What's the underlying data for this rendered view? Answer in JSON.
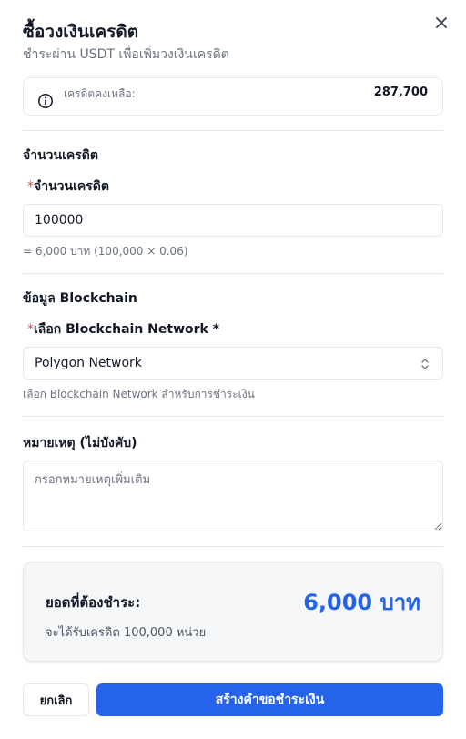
{
  "dialog": {
    "title": "ซื้อวงเงินเครดิต",
    "subtitle": "ชำระผ่าน USDT เพื่อเพิ่มวงเงินเครดิต",
    "close_icon": "close-icon"
  },
  "balance": {
    "label": "เครดิตคงเหลือ:",
    "value": "287,700",
    "icon": "info-icon"
  },
  "amount_section": {
    "title": "จำนวนเครดิต",
    "required_mark": "*",
    "field_label": "จำนวนเครดิต",
    "value": "100000",
    "calc_text": "= 6,000 บาท (100,000 × 0.06)"
  },
  "blockchain_section": {
    "title": "ข้อมูล Blockchain",
    "required_mark": "*",
    "field_label": "เลือก Blockchain Network *",
    "selected": "Polygon Network",
    "help": "เลือก Blockchain Network สำหรับการชำระเงิน"
  },
  "note_section": {
    "title": "หมายเหตุ (ไม่บังคับ)",
    "placeholder": "กรอกหมายเหตุเพิ่มเติม",
    "value": ""
  },
  "summary": {
    "label": "ยอดที่ต้องชำระ:",
    "amount": "6,000 บาท",
    "sub": "จะได้รับเครดิต 100,000 หน่วย"
  },
  "actions": {
    "cancel": "ยกเลิก",
    "submit": "สร้างคำขอชำระเงิน"
  },
  "colors": {
    "accent": "#2563eb",
    "required": "#ef4444",
    "muted": "#6b7280",
    "border": "#e5e7eb"
  }
}
